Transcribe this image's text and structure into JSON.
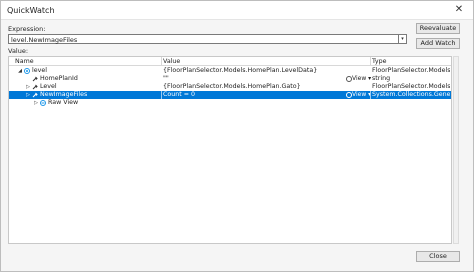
{
  "window": {
    "title": "QuickWatch",
    "close_glyph": "✕"
  },
  "expression": {
    "label": "Expression:",
    "value": "level.NewImageFiles",
    "dropdown_glyph": "▾"
  },
  "value_label": "Value:",
  "buttons": {
    "reevaluate": "Reevaluate",
    "add_watch": "Add Watch",
    "close": "Close"
  },
  "columns": {
    "name": "Name",
    "value": "Value",
    "type": "Type"
  },
  "rows": [
    {
      "name": "level",
      "value": "{FloorPlanSelector.Models.HomePlan.LevelData}",
      "type": "FloorPlanSelector.Models.HomePl...",
      "expander": "◢",
      "icon": "object-icon"
    },
    {
      "name": "HomePlanId",
      "value": "\"\"",
      "view": "View ▾",
      "type": "string",
      "expander": "",
      "icon": "wrench-icon"
    },
    {
      "name": "Level",
      "value": "{FloorPlanSelector.Models.HomePlan.Gato}",
      "type": "FloorPlanSelector.Models.HomePl...",
      "expander": "▷",
      "icon": "wrench-icon"
    },
    {
      "name": "NewImageFiles",
      "value": "Count = 0",
      "view": "View ▾",
      "type": "System.Collections.Generic.Li...",
      "expander": "▷",
      "icon": "wrench-icon"
    },
    {
      "name": "Raw View",
      "value": "",
      "type": "",
      "expander": "▷",
      "icon": "raw-view-icon"
    }
  ],
  "colors": {
    "selection": "#0078d7",
    "accent": "#1c97ea"
  }
}
